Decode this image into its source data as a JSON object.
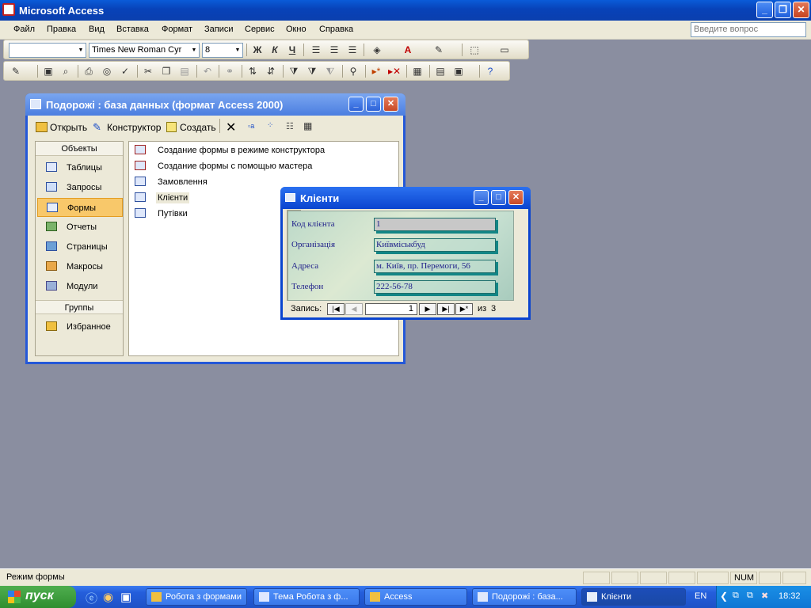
{
  "app": {
    "title": "Microsoft Access"
  },
  "menu": {
    "items": [
      "Файл",
      "Правка",
      "Вид",
      "Вставка",
      "Формат",
      "Записи",
      "Сервис",
      "Окно",
      "Справка"
    ],
    "ask_placeholder": "Введите вопрос"
  },
  "format_toolbar": {
    "object_combo": "",
    "font": "Times New Roman Cyr",
    "size": "8",
    "bold": "Ж",
    "italic": "К",
    "underline": "Ч"
  },
  "db_window": {
    "title": "Подорожі : база данных (формат Access 2000)",
    "toolbar": {
      "open": "Открыть",
      "design": "Конструктор",
      "create": "Создать"
    },
    "objects_header": "Объекты",
    "objects": [
      "Таблицы",
      "Запросы",
      "Формы",
      "Отчеты",
      "Страницы",
      "Макросы",
      "Модули"
    ],
    "selected_object": "Формы",
    "groups_header": "Группы",
    "groups": [
      "Избранное"
    ],
    "list_items": [
      "Создание формы в режиме конструктора",
      "Создание формы с помощью мастера",
      "Замовлення",
      "Клієнти",
      "Путівки"
    ]
  },
  "form_window": {
    "title": "Клієнти",
    "fields": [
      {
        "label": "Код клієнта",
        "value": "1"
      },
      {
        "label": "Організація",
        "value": "Київміськбуд"
      },
      {
        "label": "Адреса",
        "value": "м. Київ, пр. Перемоги, 56"
      },
      {
        "label": "Телефон",
        "value": "222-56-78"
      }
    ],
    "nav": {
      "label": "Запись:",
      "current": "1",
      "of_label": "из",
      "total": "3"
    }
  },
  "status": {
    "mode": "Режим формы",
    "num": "NUM"
  },
  "taskbar": {
    "start": "пуск",
    "tasks": [
      "Робота з формами",
      "Тема Робота з ф...",
      "Access",
      "Подорожі : база...",
      "Клієнти"
    ],
    "active_task": "Клієнти",
    "lang": "EN",
    "clock": "18:32"
  }
}
